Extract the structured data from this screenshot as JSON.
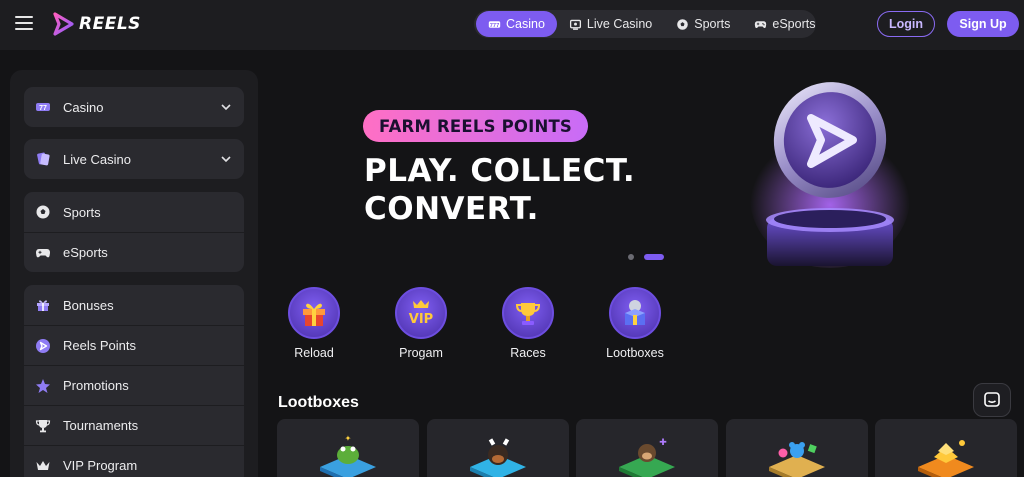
{
  "header": {
    "logo_text": "REELS",
    "nav_tabs": [
      {
        "label": "Casino",
        "icon": "casino-icon",
        "active": true
      },
      {
        "label": "Live Casino",
        "icon": "live-casino-icon",
        "active": false
      },
      {
        "label": "Sports",
        "icon": "soccer-ball-icon",
        "active": false
      },
      {
        "label": "eSports",
        "icon": "gamepad-icon",
        "active": false
      }
    ],
    "login_label": "Login",
    "signup_label": "Sign Up"
  },
  "sidebar": {
    "groups": [
      [
        {
          "label": "Casino",
          "icon": "casino-icon",
          "expandable": true
        }
      ],
      [
        {
          "label": "Live Casino",
          "icon": "live-casino-icon",
          "expandable": true
        }
      ],
      [
        {
          "label": "Sports",
          "icon": "soccer-ball-icon"
        },
        {
          "label": "eSports",
          "icon": "gamepad-icon"
        }
      ],
      [
        {
          "label": "Bonuses",
          "icon": "gift-icon"
        },
        {
          "label": "Reels Points",
          "icon": "reels-points-icon"
        },
        {
          "label": "Promotions",
          "icon": "star-icon"
        },
        {
          "label": "Tournaments",
          "icon": "trophy-icon"
        },
        {
          "label": "VIP Program",
          "icon": "crown-icon"
        }
      ]
    ]
  },
  "banner": {
    "pill_text": "FARM REELS POINTS",
    "headline_line1": "PLAY. COLLECT.",
    "headline_line2": "CONVERT.",
    "slide_count": 2,
    "active_slide": 2
  },
  "quick_links": [
    {
      "label": "Reload",
      "icon": "gift-box-icon"
    },
    {
      "label": "Progam",
      "icon": "vip-crown-icon"
    },
    {
      "label": "Races",
      "icon": "trophy-cup-icon"
    },
    {
      "label": "Lootboxes",
      "icon": "treasure-box-icon"
    }
  ],
  "lootboxes": {
    "title": "Lootboxes",
    "cards": [
      {
        "icon": "frog-lootbox-icon",
        "color": "#3aa0e0"
      },
      {
        "icon": "dog-lootbox-icon",
        "color": "#30b3e6"
      },
      {
        "icon": "monkey-lootbox-icon",
        "color": "#36a852"
      },
      {
        "icon": "gummy-bear-lootbox-icon",
        "color": "#e0b050"
      },
      {
        "icon": "gold-bar-lootbox-icon",
        "color": "#f08a1e"
      }
    ]
  },
  "colors": {
    "accent": "#7d5cf0",
    "background": "#141416",
    "panel": "#1d1d20",
    "pill_gradient_start": "#ff6fc4",
    "pill_gradient_end": "#c86cf7"
  }
}
